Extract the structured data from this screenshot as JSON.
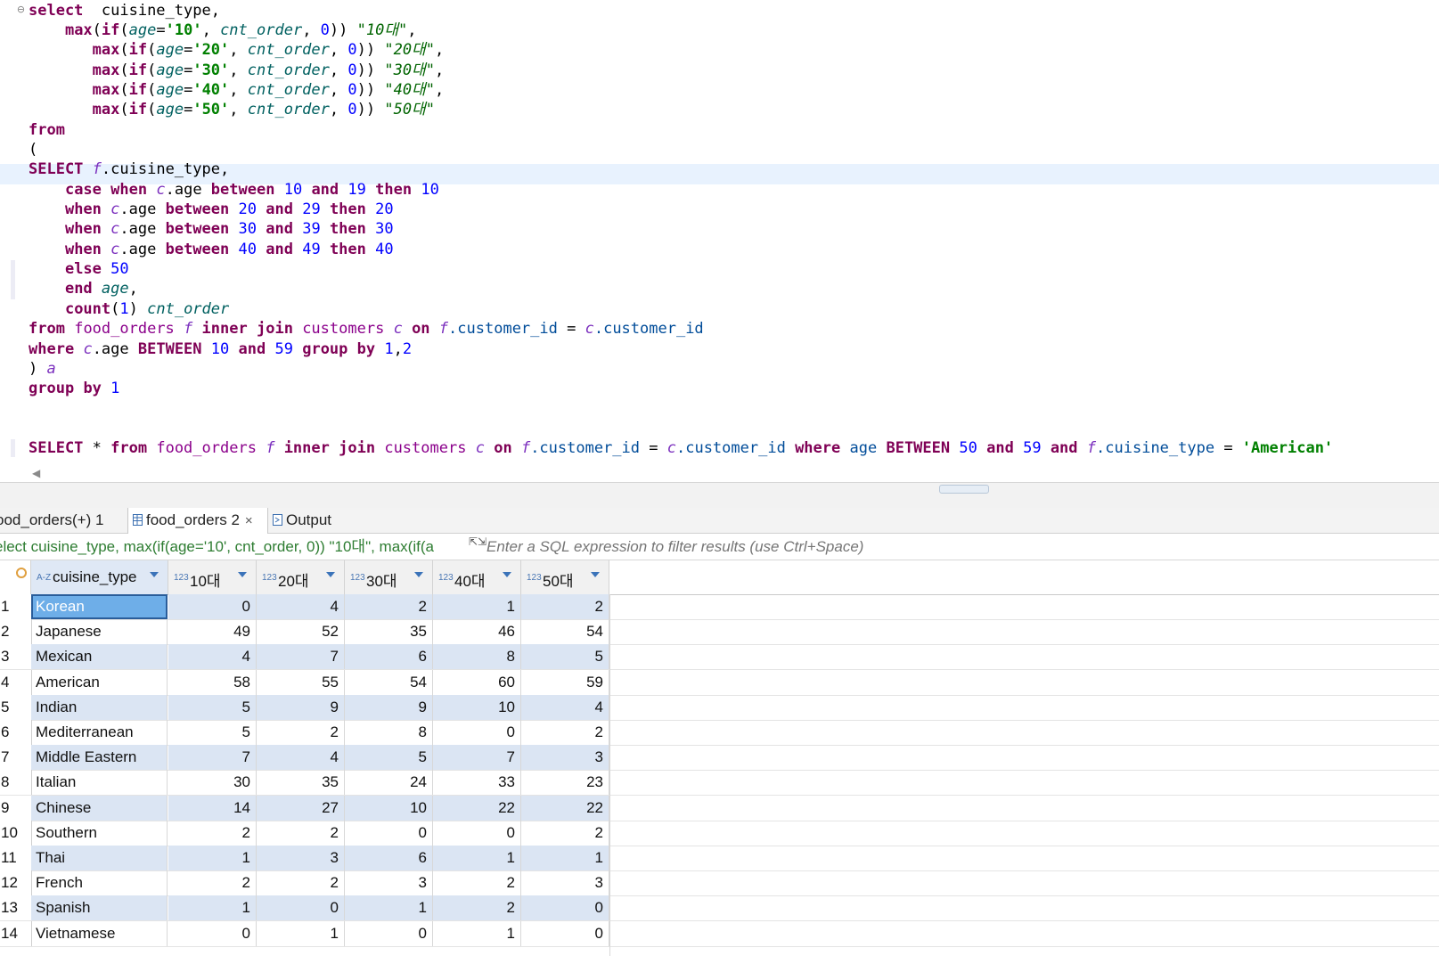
{
  "editor": {
    "fold_marker": "⊖",
    "lines": [
      [
        [
          "kw",
          "select"
        ],
        [
          "",
          "  cuisine_type,"
        ]
      ],
      [
        [
          "",
          "    "
        ],
        [
          "kw",
          "max"
        ],
        [
          "",
          "("
        ],
        [
          "kw",
          "if"
        ],
        [
          "",
          "("
        ],
        [
          "it",
          "age"
        ],
        [
          "",
          "="
        ],
        [
          "str",
          "'10'"
        ],
        [
          "",
          ", "
        ],
        [
          "it",
          "cnt_order"
        ],
        [
          "",
          ", "
        ],
        [
          "num",
          "0"
        ],
        [
          "",
          "))"
        ],
        [
          "qid",
          " \"10대\""
        ],
        [
          "",
          ","
        ]
      ],
      [
        [
          "",
          "       "
        ],
        [
          "kw",
          "max"
        ],
        [
          "",
          "("
        ],
        [
          "kw",
          "if"
        ],
        [
          "",
          "("
        ],
        [
          "it",
          "age"
        ],
        [
          "",
          "="
        ],
        [
          "str",
          "'20'"
        ],
        [
          "",
          ", "
        ],
        [
          "it",
          "cnt_order"
        ],
        [
          "",
          ", "
        ],
        [
          "num",
          "0"
        ],
        [
          "",
          "))"
        ],
        [
          "qid",
          " \"20대\""
        ],
        [
          "",
          ","
        ]
      ],
      [
        [
          "",
          "       "
        ],
        [
          "kw",
          "max"
        ],
        [
          "",
          "("
        ],
        [
          "kw",
          "if"
        ],
        [
          "",
          "("
        ],
        [
          "it",
          "age"
        ],
        [
          "",
          "="
        ],
        [
          "str",
          "'30'"
        ],
        [
          "",
          ", "
        ],
        [
          "it",
          "cnt_order"
        ],
        [
          "",
          ", "
        ],
        [
          "num",
          "0"
        ],
        [
          "",
          "))"
        ],
        [
          "qid",
          " \"30대\""
        ],
        [
          "",
          ","
        ]
      ],
      [
        [
          "",
          "       "
        ],
        [
          "kw",
          "max"
        ],
        [
          "",
          "("
        ],
        [
          "kw",
          "if"
        ],
        [
          "",
          "("
        ],
        [
          "it",
          "age"
        ],
        [
          "",
          "="
        ],
        [
          "str",
          "'40'"
        ],
        [
          "",
          ", "
        ],
        [
          "it",
          "cnt_order"
        ],
        [
          "",
          ", "
        ],
        [
          "num",
          "0"
        ],
        [
          "",
          "))"
        ],
        [
          "qid",
          " \"40대\""
        ],
        [
          "",
          ","
        ]
      ],
      [
        [
          "",
          "       "
        ],
        [
          "kw",
          "max"
        ],
        [
          "",
          "("
        ],
        [
          "kw",
          "if"
        ],
        [
          "",
          "("
        ],
        [
          "it",
          "age"
        ],
        [
          "",
          "="
        ],
        [
          "str",
          "'50'"
        ],
        [
          "",
          ", "
        ],
        [
          "it",
          "cnt_order"
        ],
        [
          "",
          ", "
        ],
        [
          "num",
          "0"
        ],
        [
          "",
          "))"
        ],
        [
          "qid",
          " \"50대\""
        ]
      ],
      [
        [
          "kw",
          "from"
        ]
      ],
      [
        [
          "",
          "("
        ]
      ],
      [
        [
          "kw",
          "SELECT"
        ],
        [
          "",
          " "
        ],
        [
          "als",
          "f"
        ],
        [
          "",
          ".cuisine_type,"
        ]
      ],
      [
        [
          "",
          "    "
        ],
        [
          "kw",
          "case"
        ],
        [
          "",
          " "
        ],
        [
          "kw",
          "when"
        ],
        [
          "",
          " "
        ],
        [
          "als",
          "c"
        ],
        [
          "",
          ".age "
        ],
        [
          "kw",
          "between"
        ],
        [
          "",
          " "
        ],
        [
          "num",
          "10"
        ],
        [
          "",
          " "
        ],
        [
          "kw",
          "and"
        ],
        [
          "",
          " "
        ],
        [
          "num",
          "19"
        ],
        [
          "",
          " "
        ],
        [
          "kw",
          "then"
        ],
        [
          "",
          " "
        ],
        [
          "num",
          "10"
        ]
      ],
      [
        [
          "",
          "    "
        ],
        [
          "kw",
          "when"
        ],
        [
          "",
          " "
        ],
        [
          "als",
          "c"
        ],
        [
          "",
          ".age "
        ],
        [
          "kw",
          "between"
        ],
        [
          "",
          " "
        ],
        [
          "num",
          "20"
        ],
        [
          "",
          " "
        ],
        [
          "kw",
          "and"
        ],
        [
          "",
          " "
        ],
        [
          "num",
          "29"
        ],
        [
          "",
          " "
        ],
        [
          "kw",
          "then"
        ],
        [
          "",
          " "
        ],
        [
          "num",
          "20"
        ]
      ],
      [
        [
          "",
          "    "
        ],
        [
          "kw",
          "when"
        ],
        [
          "",
          " "
        ],
        [
          "als",
          "c"
        ],
        [
          "",
          ".age "
        ],
        [
          "kw",
          "between"
        ],
        [
          "",
          " "
        ],
        [
          "num",
          "30"
        ],
        [
          "",
          " "
        ],
        [
          "kw",
          "and"
        ],
        [
          "",
          " "
        ],
        [
          "num",
          "39"
        ],
        [
          "",
          " "
        ],
        [
          "kw",
          "then"
        ],
        [
          "",
          " "
        ],
        [
          "num",
          "30"
        ]
      ],
      [
        [
          "",
          "    "
        ],
        [
          "kw",
          "when"
        ],
        [
          "",
          " "
        ],
        [
          "als",
          "c"
        ],
        [
          "",
          ".age "
        ],
        [
          "kw",
          "between"
        ],
        [
          "",
          " "
        ],
        [
          "num",
          "40"
        ],
        [
          "",
          " "
        ],
        [
          "kw",
          "and"
        ],
        [
          "",
          " "
        ],
        [
          "num",
          "49"
        ],
        [
          "",
          " "
        ],
        [
          "kw",
          "then"
        ],
        [
          "",
          " "
        ],
        [
          "num",
          "40"
        ]
      ],
      [
        [
          "",
          "    "
        ],
        [
          "kw",
          "else"
        ],
        [
          "",
          " "
        ],
        [
          "num",
          "50"
        ]
      ],
      [
        [
          "",
          "    "
        ],
        [
          "kw",
          "end"
        ],
        [
          "",
          " "
        ],
        [
          "it",
          "age"
        ],
        [
          "",
          ","
        ]
      ],
      [
        [
          "",
          "    "
        ],
        [
          "kw",
          "count"
        ],
        [
          "",
          "("
        ],
        [
          "num",
          "1"
        ],
        [
          "",
          ") "
        ],
        [
          "it",
          "cnt_order"
        ]
      ],
      [
        [
          "kw",
          "from"
        ],
        [
          "",
          " "
        ],
        [
          "tbl",
          "food_orders"
        ],
        [
          "",
          " "
        ],
        [
          "als",
          "f"
        ],
        [
          "",
          " "
        ],
        [
          "kw",
          "inner"
        ],
        [
          "",
          " "
        ],
        [
          "kw",
          "join"
        ],
        [
          "",
          " "
        ],
        [
          "tbl",
          "customers"
        ],
        [
          "",
          " "
        ],
        [
          "als",
          "c"
        ],
        [
          "",
          " "
        ],
        [
          "kw",
          "on"
        ],
        [
          "",
          " "
        ],
        [
          "als",
          "f"
        ],
        [
          "col",
          ".customer_id"
        ],
        [
          "",
          " = "
        ],
        [
          "als",
          "c"
        ],
        [
          "col",
          ".customer_id"
        ]
      ],
      [
        [
          "kw",
          "where"
        ],
        [
          "",
          " "
        ],
        [
          "als",
          "c"
        ],
        [
          "",
          ".age "
        ],
        [
          "kw",
          "BETWEEN"
        ],
        [
          "",
          " "
        ],
        [
          "num",
          "10"
        ],
        [
          "",
          " "
        ],
        [
          "kw",
          "and"
        ],
        [
          "",
          " "
        ],
        [
          "num",
          "59"
        ],
        [
          "",
          " "
        ],
        [
          "kw",
          "group"
        ],
        [
          "",
          " "
        ],
        [
          "kw",
          "by"
        ],
        [
          "",
          " "
        ],
        [
          "num",
          "1"
        ],
        [
          "",
          ","
        ],
        [
          "num",
          "2"
        ]
      ],
      [
        [
          "",
          ") "
        ],
        [
          "als",
          "a"
        ]
      ],
      [
        [
          "kw",
          "group"
        ],
        [
          "",
          " "
        ],
        [
          "kw",
          "by"
        ],
        [
          "",
          " "
        ],
        [
          "num",
          "1"
        ]
      ],
      [],
      [],
      [
        [
          "kw",
          "SELECT"
        ],
        [
          "",
          " * "
        ],
        [
          "kw",
          "from"
        ],
        [
          "",
          " "
        ],
        [
          "tbl",
          "food_orders"
        ],
        [
          "",
          " "
        ],
        [
          "als",
          "f"
        ],
        [
          "",
          " "
        ],
        [
          "kw",
          "inner"
        ],
        [
          "",
          " "
        ],
        [
          "kw",
          "join"
        ],
        [
          "",
          " "
        ],
        [
          "tbl",
          "customers"
        ],
        [
          "",
          " "
        ],
        [
          "als",
          "c"
        ],
        [
          "",
          " "
        ],
        [
          "kw",
          "on"
        ],
        [
          "",
          " "
        ],
        [
          "als",
          "f"
        ],
        [
          "col",
          ".customer_id"
        ],
        [
          "",
          " = "
        ],
        [
          "als",
          "c"
        ],
        [
          "col",
          ".customer_id"
        ],
        [
          "",
          " "
        ],
        [
          "kw",
          "where"
        ],
        [
          "",
          " "
        ],
        [
          "col",
          "age"
        ],
        [
          "",
          " "
        ],
        [
          "kw",
          "BETWEEN"
        ],
        [
          "",
          " "
        ],
        [
          "num",
          "50"
        ],
        [
          "",
          " "
        ],
        [
          "kw",
          "and"
        ],
        [
          "",
          " "
        ],
        [
          "num",
          "59"
        ],
        [
          "",
          " "
        ],
        [
          "kw",
          "and"
        ],
        [
          "",
          " "
        ],
        [
          "als",
          "f"
        ],
        [
          "col",
          ".cuisine_type"
        ],
        [
          "",
          " = "
        ],
        [
          "str",
          "'American'"
        ]
      ]
    ]
  },
  "tabs": [
    {
      "label": "ood_orders(+) 1",
      "active": false,
      "icon": "none"
    },
    {
      "label": "food_orders 2",
      "active": true,
      "icon": "table-icon",
      "close": "×"
    },
    {
      "label": "Output",
      "active": false,
      "icon": "output-icon"
    }
  ],
  "filter": {
    "query_text": "elect cuisine_type, max(if(age='10', cnt_order, 0)) \"10대\", max(if(a",
    "placeholder": "Enter a SQL expression to filter results (use Ctrl+Space)"
  },
  "grid": {
    "columns": [
      {
        "type_badge": "A-Z",
        "label": "cuisine_type"
      },
      {
        "type_badge": "123",
        "label": "10대"
      },
      {
        "type_badge": "123",
        "label": "20대"
      },
      {
        "type_badge": "123",
        "label": "30대"
      },
      {
        "type_badge": "123",
        "label": "40대"
      },
      {
        "type_badge": "123",
        "label": "50대"
      }
    ],
    "rows": [
      [
        "1",
        "Korean",
        "0",
        "4",
        "2",
        "1",
        "2"
      ],
      [
        "2",
        "Japanese",
        "49",
        "52",
        "35",
        "46",
        "54"
      ],
      [
        "3",
        "Mexican",
        "4",
        "7",
        "6",
        "8",
        "5"
      ],
      [
        "4",
        "American",
        "58",
        "55",
        "54",
        "60",
        "59"
      ],
      [
        "5",
        "Indian",
        "5",
        "9",
        "9",
        "10",
        "4"
      ],
      [
        "6",
        "Mediterranean",
        "5",
        "2",
        "8",
        "0",
        "2"
      ],
      [
        "7",
        "Middle Eastern",
        "7",
        "4",
        "5",
        "7",
        "3"
      ],
      [
        "8",
        "Italian",
        "30",
        "35",
        "24",
        "33",
        "23"
      ],
      [
        "9",
        "Chinese",
        "14",
        "27",
        "10",
        "22",
        "22"
      ],
      [
        "10",
        "Southern",
        "2",
        "2",
        "0",
        "0",
        "2"
      ],
      [
        "11",
        "Thai",
        "1",
        "3",
        "6",
        "1",
        "1"
      ],
      [
        "12",
        "French",
        "2",
        "2",
        "3",
        "2",
        "3"
      ],
      [
        "13",
        "Spanish",
        "1",
        "0",
        "1",
        "2",
        "0"
      ],
      [
        "14",
        "Vietnamese",
        "0",
        "1",
        "0",
        "1",
        "0"
      ]
    ]
  }
}
